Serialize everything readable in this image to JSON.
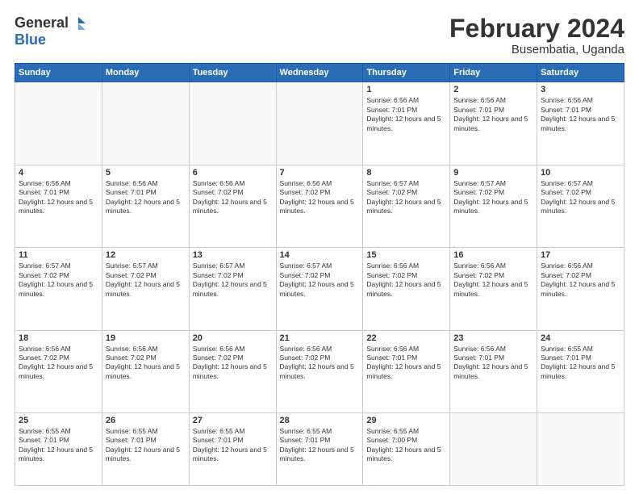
{
  "header": {
    "logo_general": "General",
    "logo_blue": "Blue",
    "title": "February 2024",
    "subtitle": "Busembatia, Uganda"
  },
  "days_of_week": [
    "Sunday",
    "Monday",
    "Tuesday",
    "Wednesday",
    "Thursday",
    "Friday",
    "Saturday"
  ],
  "weeks": [
    [
      {
        "day": "",
        "empty": true
      },
      {
        "day": "",
        "empty": true
      },
      {
        "day": "",
        "empty": true
      },
      {
        "day": "",
        "empty": true
      },
      {
        "day": "1",
        "sunrise": "6:56 AM",
        "sunset": "7:01 PM",
        "daylight": "12 hours and 5 minutes."
      },
      {
        "day": "2",
        "sunrise": "6:56 AM",
        "sunset": "7:01 PM",
        "daylight": "12 hours and 5 minutes."
      },
      {
        "day": "3",
        "sunrise": "6:56 AM",
        "sunset": "7:01 PM",
        "daylight": "12 hours and 5 minutes."
      }
    ],
    [
      {
        "day": "4",
        "sunrise": "6:56 AM",
        "sunset": "7:01 PM",
        "daylight": "12 hours and 5 minutes."
      },
      {
        "day": "5",
        "sunrise": "6:56 AM",
        "sunset": "7:01 PM",
        "daylight": "12 hours and 5 minutes."
      },
      {
        "day": "6",
        "sunrise": "6:56 AM",
        "sunset": "7:02 PM",
        "daylight": "12 hours and 5 minutes."
      },
      {
        "day": "7",
        "sunrise": "6:56 AM",
        "sunset": "7:02 PM",
        "daylight": "12 hours and 5 minutes."
      },
      {
        "day": "8",
        "sunrise": "6:57 AM",
        "sunset": "7:02 PM",
        "daylight": "12 hours and 5 minutes."
      },
      {
        "day": "9",
        "sunrise": "6:57 AM",
        "sunset": "7:02 PM",
        "daylight": "12 hours and 5 minutes."
      },
      {
        "day": "10",
        "sunrise": "6:57 AM",
        "sunset": "7:02 PM",
        "daylight": "12 hours and 5 minutes."
      }
    ],
    [
      {
        "day": "11",
        "sunrise": "6:57 AM",
        "sunset": "7:02 PM",
        "daylight": "12 hours and 5 minutes."
      },
      {
        "day": "12",
        "sunrise": "6:57 AM",
        "sunset": "7:02 PM",
        "daylight": "12 hours and 5 minutes."
      },
      {
        "day": "13",
        "sunrise": "6:57 AM",
        "sunset": "7:02 PM",
        "daylight": "12 hours and 5 minutes."
      },
      {
        "day": "14",
        "sunrise": "6:57 AM",
        "sunset": "7:02 PM",
        "daylight": "12 hours and 5 minutes."
      },
      {
        "day": "15",
        "sunrise": "6:56 AM",
        "sunset": "7:02 PM",
        "daylight": "12 hours and 5 minutes."
      },
      {
        "day": "16",
        "sunrise": "6:56 AM",
        "sunset": "7:02 PM",
        "daylight": "12 hours and 5 minutes."
      },
      {
        "day": "17",
        "sunrise": "6:56 AM",
        "sunset": "7:02 PM",
        "daylight": "12 hours and 5 minutes."
      }
    ],
    [
      {
        "day": "18",
        "sunrise": "6:56 AM",
        "sunset": "7:02 PM",
        "daylight": "12 hours and 5 minutes."
      },
      {
        "day": "19",
        "sunrise": "6:56 AM",
        "sunset": "7:02 PM",
        "daylight": "12 hours and 5 minutes."
      },
      {
        "day": "20",
        "sunrise": "6:56 AM",
        "sunset": "7:02 PM",
        "daylight": "12 hours and 5 minutes."
      },
      {
        "day": "21",
        "sunrise": "6:56 AM",
        "sunset": "7:02 PM",
        "daylight": "12 hours and 5 minutes."
      },
      {
        "day": "22",
        "sunrise": "6:56 AM",
        "sunset": "7:01 PM",
        "daylight": "12 hours and 5 minutes."
      },
      {
        "day": "23",
        "sunrise": "6:56 AM",
        "sunset": "7:01 PM",
        "daylight": "12 hours and 5 minutes."
      },
      {
        "day": "24",
        "sunrise": "6:55 AM",
        "sunset": "7:01 PM",
        "daylight": "12 hours and 5 minutes."
      }
    ],
    [
      {
        "day": "25",
        "sunrise": "6:55 AM",
        "sunset": "7:01 PM",
        "daylight": "12 hours and 5 minutes."
      },
      {
        "day": "26",
        "sunrise": "6:55 AM",
        "sunset": "7:01 PM",
        "daylight": "12 hours and 5 minutes."
      },
      {
        "day": "27",
        "sunrise": "6:55 AM",
        "sunset": "7:01 PM",
        "daylight": "12 hours and 5 minutes."
      },
      {
        "day": "28",
        "sunrise": "6:55 AM",
        "sunset": "7:01 PM",
        "daylight": "12 hours and 5 minutes."
      },
      {
        "day": "29",
        "sunrise": "6:55 AM",
        "sunset": "7:00 PM",
        "daylight": "12 hours and 5 minutes."
      },
      {
        "day": "",
        "empty": true
      },
      {
        "day": "",
        "empty": true
      }
    ]
  ]
}
